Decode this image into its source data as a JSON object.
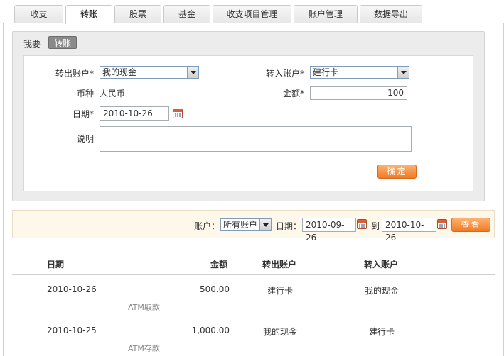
{
  "tabs": [
    {
      "label": "收支"
    },
    {
      "label": "转账"
    },
    {
      "label": "股票"
    },
    {
      "label": "基金"
    },
    {
      "label": "收支项目管理"
    },
    {
      "label": "账户管理"
    },
    {
      "label": "数据导出"
    }
  ],
  "form": {
    "heading": "我要",
    "mode": "转账",
    "from_account_label": "转出账户*",
    "from_account_value": "我的现金",
    "to_account_label": "转入账户*",
    "to_account_value": "建行卡",
    "currency_label": "币种",
    "currency_value": "人民币",
    "amount_label": "金额*",
    "amount_value": "100",
    "date_label": "日期*",
    "date_value": "2010-10-26",
    "note_label": "说明",
    "note_value": "",
    "submit_label": "确定"
  },
  "filter": {
    "account_label": "账户：",
    "account_value": "所有账户",
    "date_label": "日期：",
    "date_from": "2010-09-26",
    "to_label": "到",
    "date_to": "2010-10-26",
    "view_label": "查看"
  },
  "table": {
    "headers": {
      "date": "日期",
      "amount": "金额",
      "from": "转出账户",
      "to": "转入账户"
    },
    "rows": [
      {
        "date": "2010-10-26",
        "amount": "500.00",
        "from": "建行卡",
        "to": "我的现金",
        "note": "ATM取款"
      },
      {
        "date": "2010-10-25",
        "amount": "1,000.00",
        "from": "我的现金",
        "to": "建行卡",
        "note": "ATM存款"
      }
    ]
  },
  "colors": {
    "accent_orange": "#f07a25",
    "filter_bg": "#fdf8ea",
    "form_bg": "#ececec",
    "badge_gray": "#8a8a8a"
  }
}
